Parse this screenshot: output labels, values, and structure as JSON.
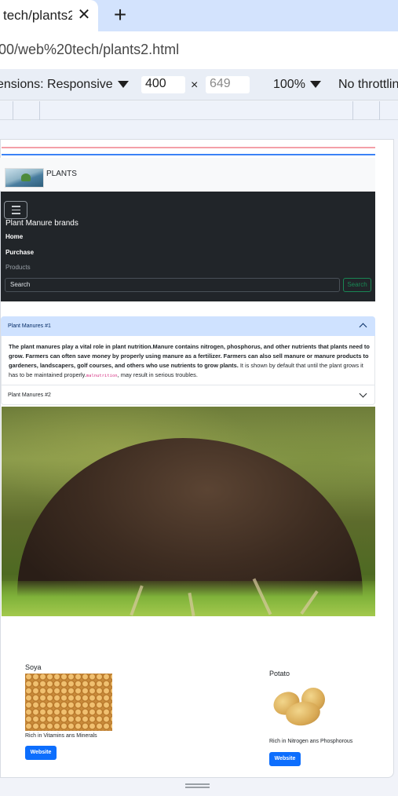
{
  "browser": {
    "tab_title": "tech/plants2.",
    "tab_title_fade": "",
    "new_tab_symbol": "+",
    "close_symbol": "✕",
    "url": "00/web%20tech/plants2.html"
  },
  "devtools": {
    "dimensions_label": "ensions: Responsive",
    "width": "400",
    "x_symbol": "×",
    "height": "649",
    "zoom": "100%",
    "throttling": "No throttlin"
  },
  "page": {
    "brand": "PLANTS",
    "navbar": {
      "title": "Plant Manure brands",
      "links": [
        "Home",
        "Purchase",
        "Products"
      ],
      "search_placeholder": "Search",
      "search_button": "Search"
    },
    "accordion": {
      "item1_title": "Plant Manures #1",
      "item1_bold": "The plant manures play a vital role in plant nutrition.Manure contains nitrogen, phosphorus, and other nutrients that plants need to grow. Farmers can often save money by properly using manure as a fertilizer. Farmers can also sell manure or manure products to gardeners, landscapers, golf courses, and others who use nutrients to grow plants.",
      "item1_normal": " It is shown by default that until the plant grows it has to be maintained properly.",
      "item1_code": "malnutrition",
      "item1_tail": ", may result in serious troubles.",
      "item2_title": "Plant Manures #2"
    },
    "cards": [
      {
        "title": "Soya",
        "text": "Rich in Vitamins ans Minerals",
        "button": "Website"
      },
      {
        "title": "Potato",
        "text": "Rich in Nitrogen ans Phosphorous",
        "button": "Website"
      }
    ]
  }
}
